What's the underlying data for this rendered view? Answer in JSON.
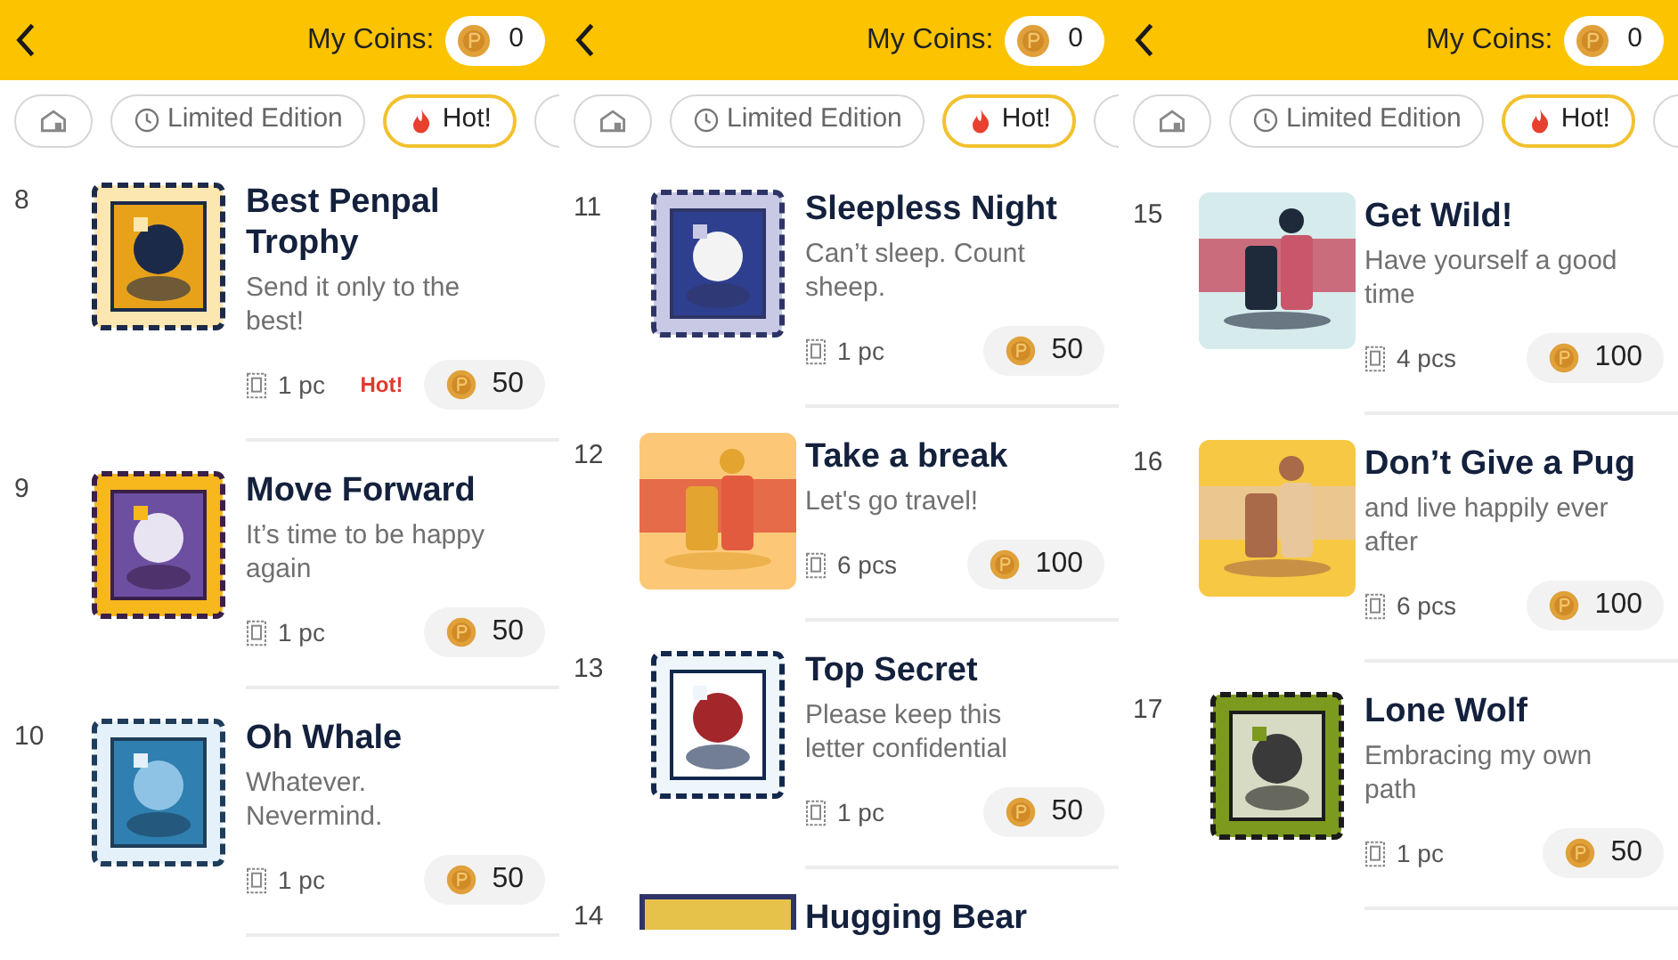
{
  "panels": [
    {
      "coins_label": "My Coins:",
      "coins": "0",
      "tabs": [
        {
          "kind": "home",
          "selected": false
        },
        {
          "kind": "clock",
          "label": "Limited Edition",
          "selected": false
        },
        {
          "kind": "flame",
          "label": "Hot!",
          "selected": true
        }
      ],
      "items": [
        {
          "number": "8",
          "title": "Best Penpal Trophy",
          "description": "Send it only to the best!",
          "quantity": "1 pc",
          "badge": "Hot!",
          "price": "50"
        },
        {
          "number": "9",
          "title": "Move Forward",
          "description": "It’s time to be happy again",
          "quantity": "1 pc",
          "price": "50"
        },
        {
          "number": "10",
          "title": "Oh Whale",
          "description": "Whatever. Nevermind.",
          "quantity": "1 pc",
          "price": "50"
        }
      ]
    },
    {
      "coins_label": "My Coins:",
      "coins": "0",
      "tabs": [
        {
          "kind": "home",
          "selected": false
        },
        {
          "kind": "clock",
          "label": "Limited Edition",
          "selected": false
        },
        {
          "kind": "flame",
          "label": "Hot!",
          "selected": true
        }
      ],
      "items": [
        {
          "number": "11",
          "title": "Sleepless Night",
          "description": "Can’t sleep. Count sheep.",
          "quantity": "1 pc",
          "price": "50"
        },
        {
          "number": "12",
          "title": "Take a break",
          "description": "Let's go travel!",
          "quantity": "6 pcs",
          "price": "100"
        },
        {
          "number": "13",
          "title": "Top Secret",
          "description": "Please keep this letter confidential",
          "quantity": "1 pc",
          "price": "50"
        },
        {
          "number": "14",
          "title": "Hugging Bear"
        }
      ]
    },
    {
      "coins_label": "My Coins:",
      "coins": "0",
      "tabs": [
        {
          "kind": "home",
          "selected": false
        },
        {
          "kind": "clock",
          "label": "Limited Edition",
          "selected": false
        },
        {
          "kind": "flame",
          "label": "Hot!",
          "selected": true
        }
      ],
      "items": [
        {
          "number": "15",
          "title": "Get Wild!",
          "description": "Have yourself a good time",
          "quantity": "4 pcs",
          "price": "100"
        },
        {
          "number": "16",
          "title": "Don’t Give a Pug",
          "description": "and live happily ever after",
          "quantity": "6 pcs",
          "price": "100"
        },
        {
          "number": "17",
          "title": "Lone Wolf",
          "description": "Embracing my own path",
          "quantity": "1 pc",
          "price": "50"
        }
      ]
    }
  ]
}
